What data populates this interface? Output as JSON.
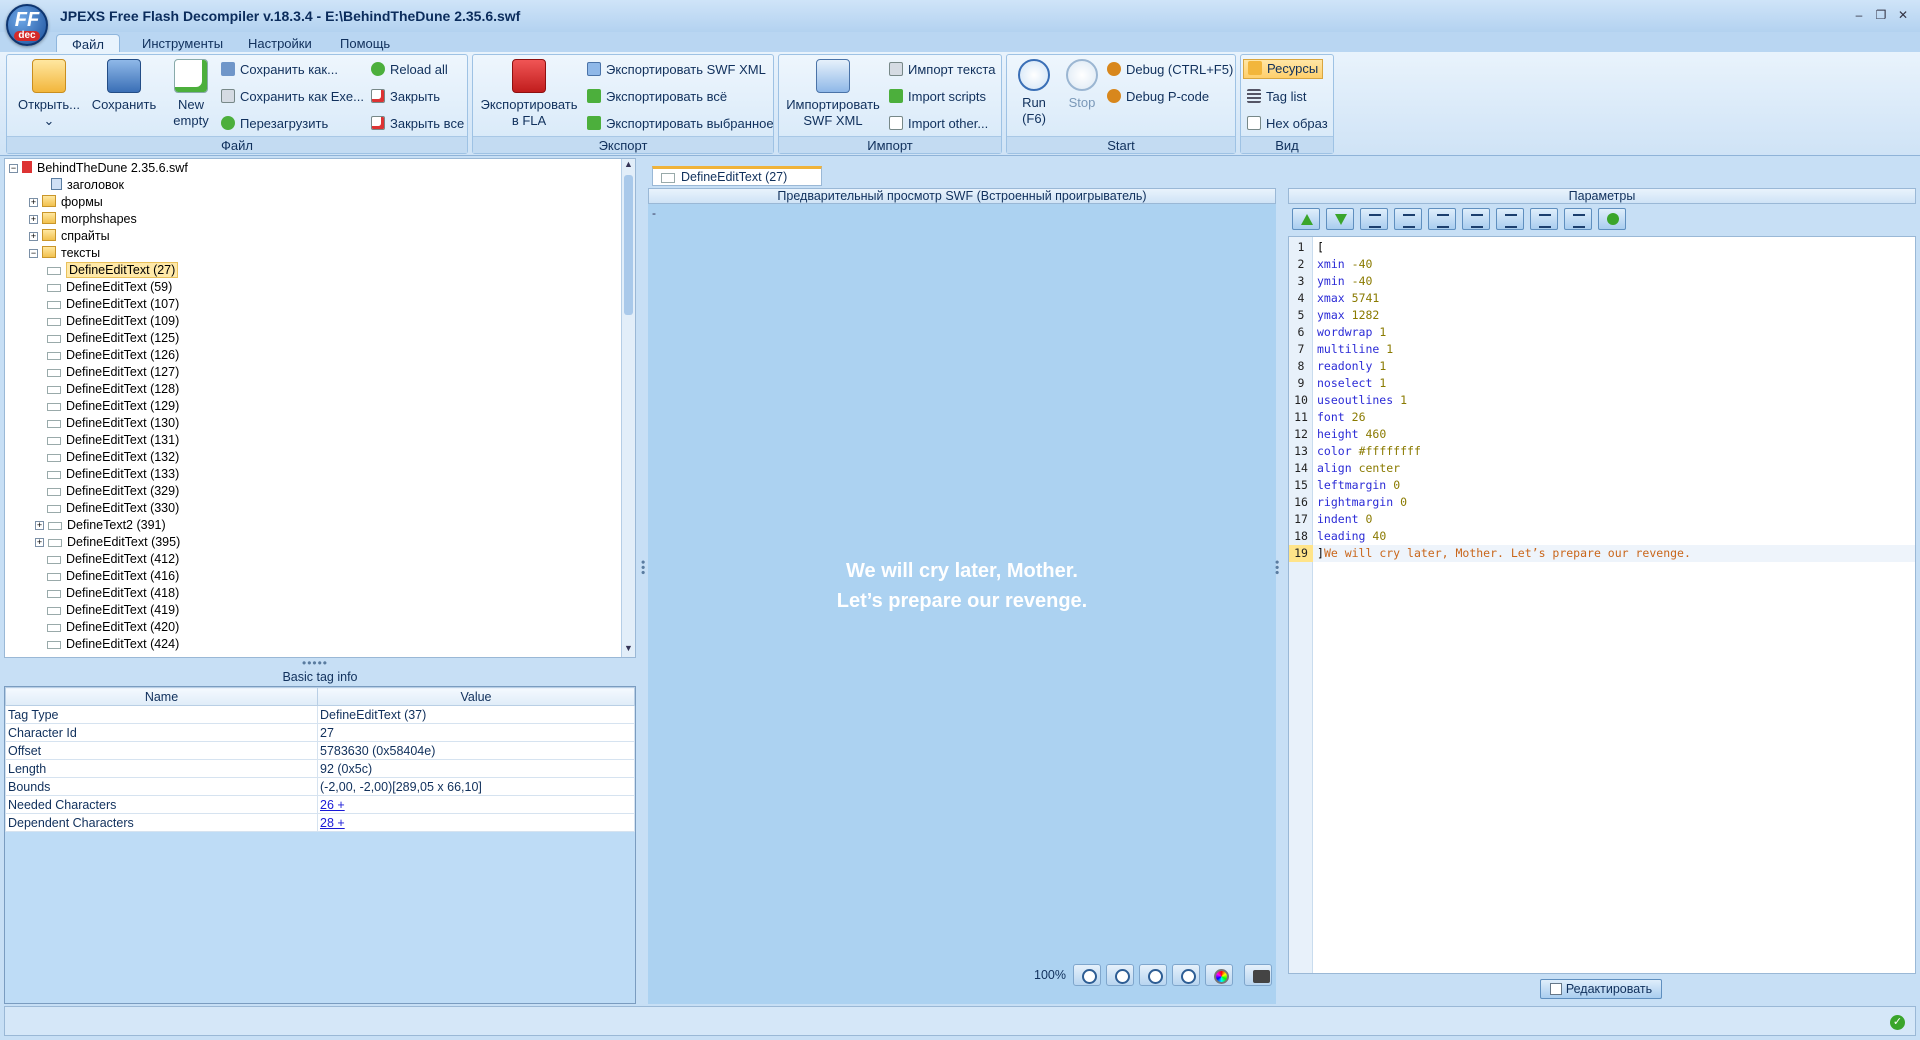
{
  "window": {
    "title": "JPEXS Free Flash Decompiler v.18.3.4 - E:\\BehindTheDune 2.35.6.swf",
    "logo_ff": "FF",
    "logo_dec": "dec",
    "min": "–",
    "restore": "❐",
    "close": "✕"
  },
  "menu": {
    "tabs": [
      "Файл",
      "Инструменты",
      "Настройки",
      "Помощь"
    ]
  },
  "ribbon": {
    "file_group": {
      "label": "Файл",
      "open": "Открыть...",
      "open_arrow": "⌄",
      "save": "Сохранить",
      "new_empty": [
        "New",
        "empty"
      ],
      "save_as": "Сохранить как...",
      "save_as_exe": "Сохранить как Exe...",
      "reload": "Перезагрузить",
      "reload_all": "Reload all",
      "close": "Закрыть",
      "close_all": "Закрыть все"
    },
    "export_group": {
      "label": "Экспорт",
      "export_fla": [
        "Экспортировать",
        "в FLA"
      ],
      "export_swf_xml": "Экспортировать SWF XML",
      "export_all": "Экспортировать всё",
      "export_selected": "Экспортировать выбранное"
    },
    "import_group": {
      "label": "Импорт",
      "import_swf_xml": [
        "Импортировать",
        "SWF XML"
      ],
      "import_text": "Импорт текста",
      "import_scripts": "Import scripts",
      "import_other": "Import other..."
    },
    "start_group": {
      "label": "Start",
      "run": [
        "Run",
        "(F6)"
      ],
      "stop": "Stop",
      "debug": "Debug (CTRL+F5)",
      "debug_pcode": "Debug P-code"
    },
    "view_group": {
      "label": "Вид",
      "resources": "Ресурсы",
      "tag_list": "Tag list",
      "hex": "Hex образ"
    }
  },
  "tree": {
    "root": "BehindTheDune 2.35.6.swf",
    "items": [
      "заголовок",
      "формы",
      "morphshapes",
      "спрайты",
      "тексты",
      "DefineEditText (27)",
      "DefineEditText (59)",
      "DefineEditText (107)",
      "DefineEditText (109)",
      "DefineEditText (125)",
      "DefineEditText (126)",
      "DefineEditText (127)",
      "DefineEditText (128)",
      "DefineEditText (129)",
      "DefineEditText (130)",
      "DefineEditText (131)",
      "DefineEditText (132)",
      "DefineEditText (133)",
      "DefineEditText (329)",
      "DefineEditText (330)",
      "DefineText2 (391)",
      "DefineEditText (395)",
      "DefineEditText (412)",
      "DefineEditText (416)",
      "DefineEditText (418)",
      "DefineEditText (419)",
      "DefineEditText (420)",
      "DefineEditText (424)"
    ],
    "expander_plus": "+",
    "expander_minus": "−"
  },
  "info": {
    "title": "Basic tag info",
    "headers": [
      "Name",
      "Value"
    ],
    "rows": [
      [
        "Tag Type",
        "DefineEditText (37)"
      ],
      [
        "Character Id",
        "27"
      ],
      [
        "Offset",
        "5783630 (0x58404e)"
      ],
      [
        "Length",
        "92 (0x5c)"
      ],
      [
        "Bounds",
        "(-2,00, -2,00)[289,05 x 66,10]"
      ],
      [
        "Needed Characters",
        "26 +"
      ],
      [
        "Dependent Characters",
        "28 +"
      ]
    ]
  },
  "preview": {
    "tab": "DefineEditText (27)",
    "header": "Предварительный просмотр SWF (Встроенный проигрыватель)",
    "dash": "-",
    "line1": "We will cry later, Mother.",
    "line2": "Let’s prepare our revenge.",
    "zoom": "100%"
  },
  "params": {
    "header": "Параметры",
    "edit_button": "Редактировать",
    "code": [
      {
        "k": "[",
        "v": ""
      },
      {
        "k": "xmin",
        "v": "-40"
      },
      {
        "k": "ymin",
        "v": "-40"
      },
      {
        "k": "xmax",
        "v": "5741"
      },
      {
        "k": "ymax",
        "v": "1282"
      },
      {
        "k": "wordwrap",
        "v": "1"
      },
      {
        "k": "multiline",
        "v": "1"
      },
      {
        "k": "readonly",
        "v": "1"
      },
      {
        "k": "noselect",
        "v": "1"
      },
      {
        "k": "useoutlines",
        "v": "1"
      },
      {
        "k": "font",
        "v": "26"
      },
      {
        "k": "height",
        "v": "460"
      },
      {
        "k": "color",
        "v": "#ffffffff"
      },
      {
        "k": "align",
        "v": "center"
      },
      {
        "k": "leftmargin",
        "v": "0"
      },
      {
        "k": "rightmargin",
        "v": "0"
      },
      {
        "k": "indent",
        "v": "0"
      },
      {
        "k": "leading",
        "v": "40"
      },
      {
        "k": "]",
        "v": "We will cry later, Mother. Let’s prepare our revenge."
      }
    ]
  },
  "status": {
    "ok_icon": "✓"
  }
}
